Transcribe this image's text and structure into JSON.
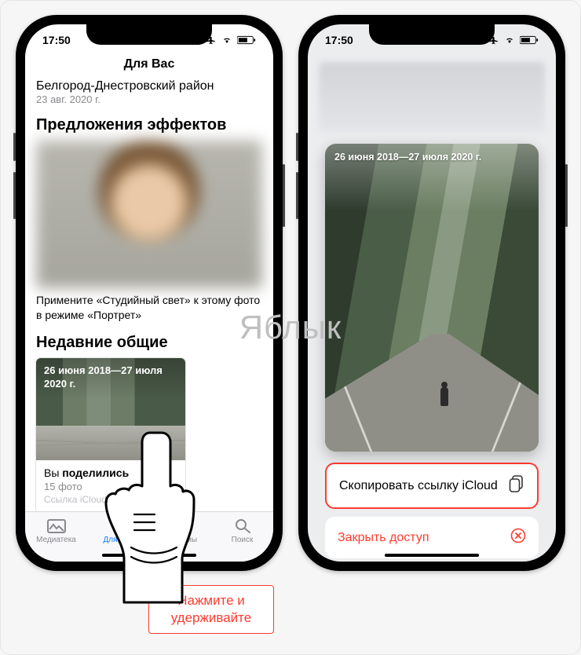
{
  "status": {
    "time": "17:50"
  },
  "watermark": "Яблык",
  "left": {
    "nav_title": "Для Вас",
    "memory": {
      "title": "Белгород-Днестровский район",
      "date": "23 авг. 2020 г."
    },
    "effects": {
      "title": "Предложения эффектов",
      "caption": "Примените «Студийный свет» к этому фото в режиме «Портрет»"
    },
    "recent": {
      "title": "Недавние общие",
      "range": "26 июня 2018—27 июля 2020 г.",
      "you_prefix": "Вы ",
      "you_shared": "поделились",
      "count": "15 фото",
      "link_hint": "Ссылка iCloud доступна"
    },
    "tabs": {
      "library": "Медиатека",
      "for_you": "Для Вас",
      "albums": "Альбомы",
      "search": "Поиск"
    }
  },
  "right": {
    "preview_range": "26 июня 2018—27 июля 2020 г.",
    "copy_label": "Скопировать ссылку iCloud",
    "close_label": "Закрыть доступ"
  },
  "callout": "Нажмите и удерживайте"
}
